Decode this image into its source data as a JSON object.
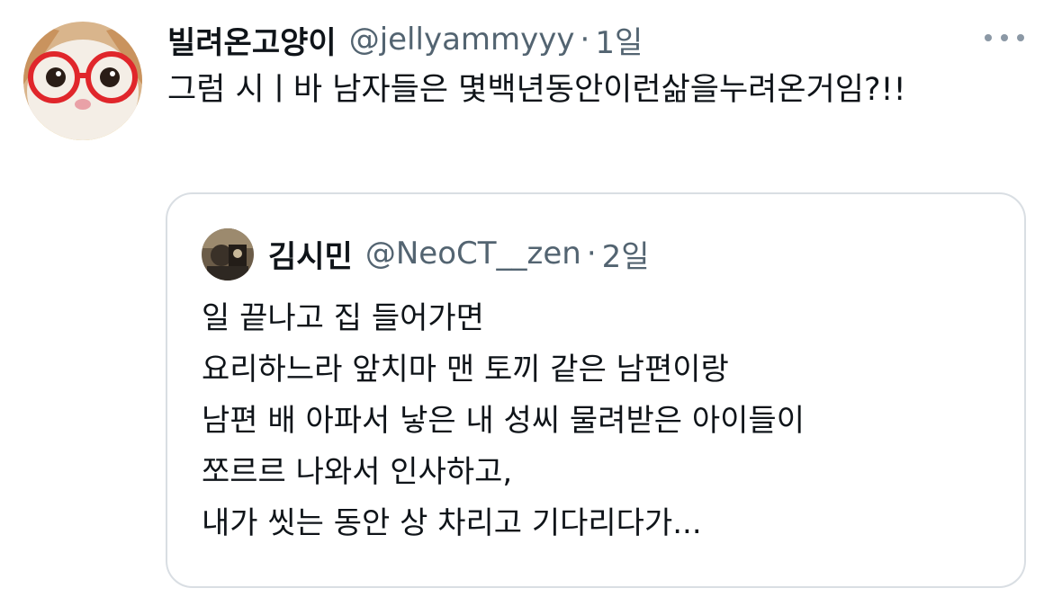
{
  "tweet": {
    "author": {
      "display_name": "빌려온고양이",
      "handle": "@jellyammyyy",
      "avatar_icon": "cat-with-red-glasses-avatar"
    },
    "separator": "·",
    "time": "1일",
    "more_icon": "more-dots-icon",
    "text": "그럼 시ㅣ바 남자들은 몇백년동안이런삶을누려온거임?!!"
  },
  "quoted": {
    "author": {
      "display_name": "김시민",
      "handle": "@NeoCT__zen",
      "avatar_icon": "photo-avatar"
    },
    "separator": "·",
    "time": "2일",
    "lines": [
      "일 끝나고 집 들어가면",
      "요리하느라 앞치마 맨 토끼 같은 남편이랑",
      "남편 배 아파서 낳은 내 성씨 물려받은 아이들이",
      "쪼르르 나와서 인사하고,",
      "내가 씻는 동안 상 차리고 기다리다가..."
    ]
  },
  "colors": {
    "text_primary": "#0f1419",
    "text_secondary": "#536471",
    "border": "#d9dee3"
  }
}
